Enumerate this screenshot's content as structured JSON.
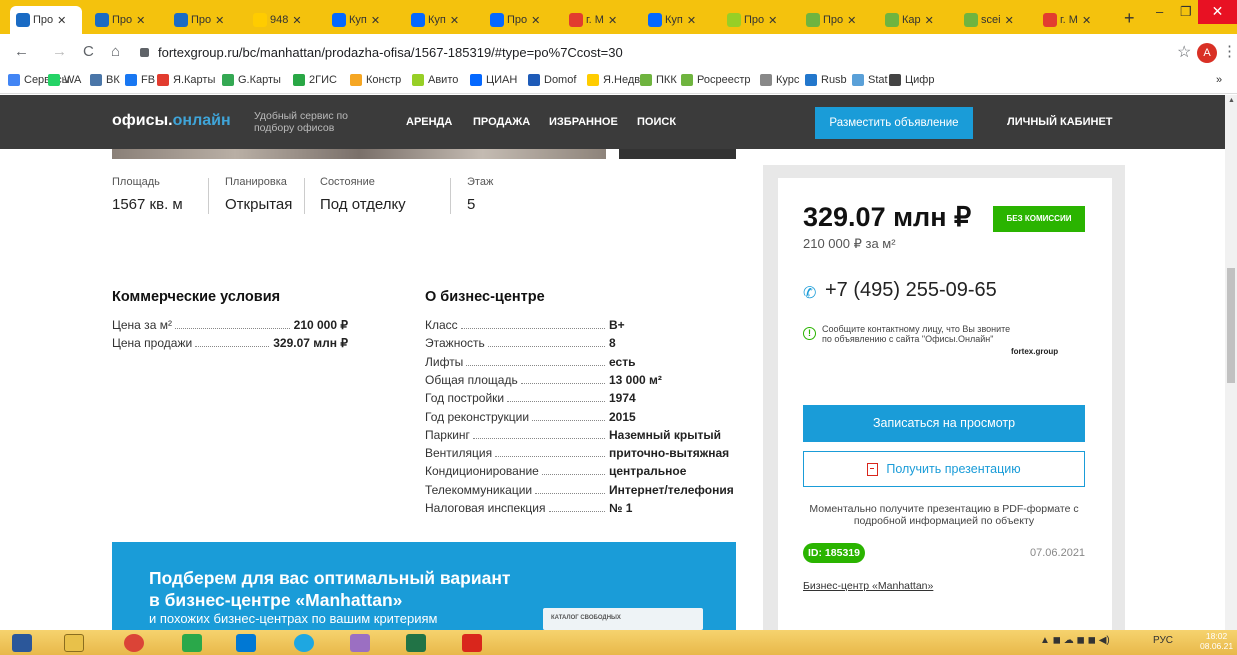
{
  "browser": {
    "tabs": [
      {
        "label": "Про",
        "active": true
      },
      {
        "label": "Про"
      },
      {
        "label": "Про"
      },
      {
        "label": "948"
      },
      {
        "label": "Куп"
      },
      {
        "label": "Куп"
      },
      {
        "label": "Про"
      },
      {
        "label": "г. М"
      },
      {
        "label": "Куп"
      },
      {
        "label": "Про"
      },
      {
        "label": "Про"
      },
      {
        "label": "Кар"
      },
      {
        "label": "scei"
      },
      {
        "label": "г. М"
      }
    ],
    "new_tab": "+",
    "url": "fortexgroup.ru/bc/manhattan/prodazha-ofisa/1567-185319/#type=po%7Ccost=30",
    "avatar_letter": "A",
    "bookmarks": [
      {
        "label": "Сервисы",
        "color": "#4285f4"
      },
      {
        "label": "WA",
        "color": "#25d366"
      },
      {
        "label": "ВК",
        "color": "#4a76a8"
      },
      {
        "label": "FB",
        "color": "#1877f2"
      },
      {
        "label": "Я.Карты",
        "color": "#e23c2f"
      },
      {
        "label": "G.Карты",
        "color": "#34a853"
      },
      {
        "label": "2ГИС",
        "color": "#29a745"
      },
      {
        "label": "Констр",
        "color": "#f5a623"
      },
      {
        "label": "Авито",
        "color": "#97cf26"
      },
      {
        "label": "ЦИАН",
        "color": "#0468ff"
      },
      {
        "label": "Domof",
        "color": "#1e5bb8"
      },
      {
        "label": "Я.Недв",
        "color": "#ffcc00"
      },
      {
        "label": "ПКК",
        "color": "#6fb43f"
      },
      {
        "label": "Росреестр",
        "color": "#6fb43f"
      },
      {
        "label": "Курс",
        "color": "#888888"
      },
      {
        "label": "Rusb",
        "color": "#2277cc"
      },
      {
        "label": "Stat",
        "color": "#5aa0d8"
      },
      {
        "label": "Цифр",
        "color": "#444444"
      }
    ],
    "bookmarks_more": "»"
  },
  "site": {
    "logo_a": "офисы.",
    "logo_b": "онлайн",
    "tagline": "Удобный сервис по подбору офисов",
    "nav": [
      "АРЕНДА",
      "ПРОДАЖА",
      "ИЗБРАННОЕ",
      "ПОИСК"
    ],
    "post_button": "Разместить объявление",
    "cabinet": "ЛИЧНЫЙ КАБИНЕТ"
  },
  "specs": [
    {
      "label": "Площадь",
      "value": "1567 кв. м"
    },
    {
      "label": "Планировка",
      "value": "Открытая"
    },
    {
      "label": "Состояние",
      "value": "Под отделку"
    },
    {
      "label": "Этаж",
      "value": "5"
    }
  ],
  "commercial": {
    "title": "Коммерческие условия",
    "rows": [
      {
        "k": "Цена за м²",
        "v": "210 000 ₽"
      },
      {
        "k": "Цена продажи",
        "v": "329.07 млн ₽"
      }
    ]
  },
  "bc": {
    "title": "О бизнес-центре",
    "rows": [
      {
        "k": "Класс",
        "v": "B+"
      },
      {
        "k": "Этажность",
        "v": "8"
      },
      {
        "k": "Лифты",
        "v": "есть"
      },
      {
        "k": "Общая площадь",
        "v": "13 000 м²"
      },
      {
        "k": "Год постройки",
        "v": "1974"
      },
      {
        "k": "Год реконструкции",
        "v": "2015"
      },
      {
        "k": "Паркинг",
        "v": "Наземный крытый"
      },
      {
        "k": "Вентиляция",
        "v": "приточно-вытяжная"
      },
      {
        "k": "Кондиционирование",
        "v": "центральное"
      },
      {
        "k": "Телекоммуникации",
        "v": "Интернет/телефония"
      },
      {
        "k": "Налоговая инспекция",
        "v": "№ 1"
      }
    ]
  },
  "banner": {
    "line1": "Подберем для вас оптимальный вариант",
    "line2": "в бизнес-центре «Manhattan»",
    "line3": "и похожих бизнес-центрах по вашим критериям",
    "catalog": "КАТАЛОГ СВОБОДНЫХ"
  },
  "card": {
    "price": "329.07 млн ₽",
    "no_commission": "БЕЗ КОМИССИИ",
    "price_per_m2": "210 000 ₽ за м²",
    "phone": "+7 (495) 255-09-65",
    "notice": "Сообщите контактному лицу, что Вы звоните по объявлению с сайта \"Офисы.Онлайн\"",
    "agency": "fortex.group",
    "book_button": "Записаться на просмотр",
    "presentation_button": "Получить презентацию",
    "presentation_note": "Моментально получите презентацию в PDF-формате с подробной информацией по объекту",
    "id": "ID: 185319",
    "date": "07.06.2021",
    "bc_link": "Бизнес-центр «Manhattan»"
  },
  "taskbar": {
    "lang": "РУС",
    "time": "18:02",
    "date": "08.06.21"
  }
}
